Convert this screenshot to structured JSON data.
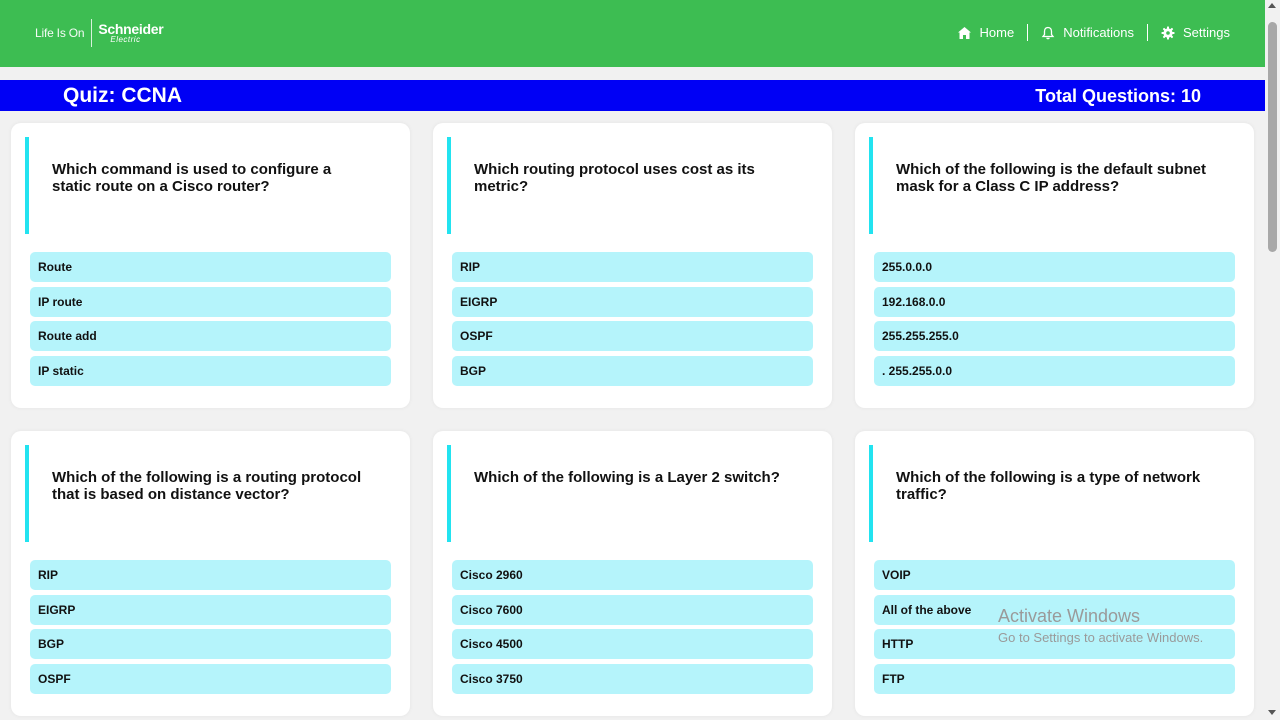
{
  "header": {
    "logo_tagline": "Life Is On",
    "logo_brand": "Schneider",
    "logo_sub": "Electric",
    "nav": [
      {
        "label": "Home",
        "icon": "home-icon"
      },
      {
        "label": "Notifications",
        "icon": "bell-icon"
      },
      {
        "label": "Settings",
        "icon": "gear-icon"
      }
    ],
    "bg_color": "#3dbd52"
  },
  "quiz": {
    "title": "Quiz: CCNA",
    "total": "Total Questions: 10",
    "bar_color": "#0000f5"
  },
  "cards": [
    {
      "question": "Which command is used to configure a static route on a Cisco router?",
      "options": [
        "Route",
        "IP route",
        "Route add",
        "IP static"
      ]
    },
    {
      "question": "Which routing protocol uses cost as its metric?",
      "options": [
        "RIP",
        "EIGRP",
        "OSPF",
        "BGP"
      ]
    },
    {
      "question": "Which of the following is the default subnet mask for a Class C IP address?",
      "options": [
        "255.0.0.0",
        "192.168.0.0",
        "255.255.255.0",
        ". 255.255.0.0"
      ]
    },
    {
      "question": "Which of the following is a routing protocol that is based on distance vector?",
      "options": [
        "RIP",
        "EIGRP",
        "BGP",
        "OSPF"
      ]
    },
    {
      "question": "Which of the following is a Layer 2 switch?",
      "options": [
        "Cisco 2960",
        "Cisco 7600",
        "Cisco 4500",
        "Cisco 3750"
      ]
    },
    {
      "question": "Which of the following is a type of network traffic?",
      "options": [
        "VOIP",
        "All of the above",
        "HTTP",
        "FTP"
      ]
    }
  ],
  "option_color": "#b5f4fb",
  "accent_color": "#22e3f0",
  "watermark": {
    "line1": "Activate Windows",
    "line2": "Go to Settings to activate Windows."
  }
}
